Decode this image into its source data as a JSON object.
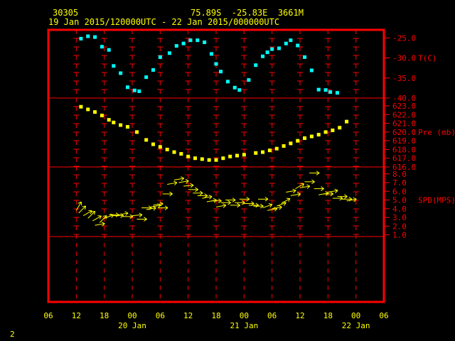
{
  "header": {
    "station": "30305",
    "location": "75.89S  -25.83E  3661M",
    "period": "19 Jan 2015/120000UTC - 22 Jan 2015/000000UTC"
  },
  "page_number": "2",
  "colors": {
    "frame": "#ff0000",
    "grid": "#ff0000",
    "header_text": "#ffff00",
    "time_labels": "#ffff00",
    "axis_labels": "#ff0000",
    "temperature": "#00ffff",
    "pressure": "#ffff00",
    "wind": "#ffff00"
  },
  "chart_data": {
    "type": "scatter",
    "x_axis": {
      "hour_ticks": [
        "06",
        "12",
        "18",
        "00",
        "06",
        "12",
        "18",
        "00",
        "06",
        "12",
        "18",
        "00",
        "06"
      ],
      "tick_hours_since_19jan_00utc": [
        6,
        12,
        18,
        24,
        30,
        36,
        42,
        48,
        54,
        60,
        66,
        72,
        78
      ],
      "day_labels": [
        "20 Jan",
        "21 Jan",
        "22 Jan"
      ],
      "day_label_hours_since_19jan_00utc": [
        24,
        48,
        72
      ]
    },
    "panels": [
      {
        "name": "temperature",
        "label": "T(C)",
        "ticks": [
          "-25.0",
          "-30.0",
          "-35.0",
          "-40.0"
        ],
        "tick_values": [
          -25,
          -30,
          -35,
          -40
        ],
        "ylim": [
          -40,
          -23
        ],
        "marker": "square",
        "x": [
          13,
          14.5,
          16,
          17.5,
          19,
          20,
          21.5,
          23,
          24.5,
          25.5,
          27,
          28.5,
          30,
          32,
          33.5,
          35,
          36.5,
          38,
          39.5,
          41,
          42,
          43,
          44.5,
          46,
          47,
          49,
          50.5,
          52,
          53,
          54,
          55.5,
          57,
          58,
          59.5,
          61,
          62.5,
          64,
          65.5,
          66.5,
          68
        ],
        "y": [
          -25.2,
          -24.6,
          -24.8,
          -27.2,
          -28.0,
          -32.0,
          -33.8,
          -37.3,
          -38.1,
          -38.3,
          -34.8,
          -33.0,
          -29.8,
          -28.8,
          -27.0,
          -26.4,
          -25.6,
          -25.6,
          -26.1,
          -29.0,
          -31.5,
          -33.4,
          -35.9,
          -37.4,
          -38.0,
          -35.5,
          -31.8,
          -29.6,
          -28.6,
          -27.8,
          -27.6,
          -26.4,
          -25.6,
          -26.9,
          -29.8,
          -33.1,
          -37.9,
          -38.0,
          -38.5,
          -38.7
        ]
      },
      {
        "name": "pressure",
        "label": "Pre (mb)",
        "ticks": [
          "623.0",
          "622.0",
          "621.0",
          "620.0",
          "619.0",
          "618.0",
          "617.0",
          "616.0"
        ],
        "tick_values": [
          623,
          622,
          621,
          620,
          619,
          618,
          617,
          616
        ],
        "ylim": [
          616,
          623.9
        ],
        "marker": "square",
        "x": [
          13,
          14.5,
          16,
          17.5,
          19,
          20,
          21.5,
          23,
          25,
          27,
          28.5,
          30,
          31.5,
          33,
          34.5,
          36,
          37.5,
          39,
          40.5,
          42,
          43.5,
          45,
          46.5,
          48,
          50.5,
          52,
          53.5,
          55,
          56.5,
          58,
          59.5,
          61,
          62.5,
          64,
          65.5,
          67,
          68.5,
          70
        ],
        "y": [
          622.9,
          622.6,
          622.3,
          621.9,
          621.4,
          621.1,
          620.8,
          620.6,
          620.0,
          619.1,
          618.6,
          618.3,
          618.0,
          617.7,
          617.5,
          617.2,
          617.0,
          616.9,
          616.8,
          616.8,
          617.0,
          617.2,
          617.3,
          617.4,
          617.6,
          617.7,
          617.9,
          618.1,
          618.4,
          618.7,
          619.0,
          619.3,
          619.5,
          619.7,
          620.0,
          620.2,
          620.5,
          621.2
        ]
      },
      {
        "name": "wind_speed",
        "label": "SPD(MPS)",
        "ticks": [
          "8.0",
          "7.0",
          "6.0",
          "5.0",
          "4.0",
          "3.0",
          "2.0",
          "1.0"
        ],
        "tick_values": [
          8,
          7,
          6,
          5,
          4,
          3,
          2,
          1
        ],
        "ylim": [
          0.8,
          8.8
        ],
        "marker": "wind-arrow",
        "x": [
          12,
          12.5,
          13.5,
          14.5,
          15.5,
          16,
          17,
          18,
          19,
          20,
          21,
          22,
          24,
          25,
          26,
          27,
          28,
          28.5,
          29.5,
          30.5,
          31.5,
          33,
          34,
          35,
          36,
          37,
          38,
          39,
          40,
          41,
          42,
          43,
          44,
          45,
          46,
          47,
          48,
          49,
          50,
          51,
          52,
          53,
          54,
          55,
          56,
          57,
          58,
          59,
          60,
          61,
          62,
          63,
          64,
          65,
          66,
          67,
          68,
          69,
          70
        ],
        "y": [
          3.8,
          3.5,
          3.2,
          2.9,
          2.6,
          2.1,
          2.4,
          2.9,
          3.3,
          3.2,
          3.3,
          3.1,
          3.2,
          2.8,
          4.1,
          3.9,
          4.2,
          4.4,
          4.1,
          5.7,
          6.8,
          7.3,
          7.0,
          6.6,
          6.2,
          5.8,
          5.5,
          5.2,
          4.8,
          4.9,
          4.2,
          4.7,
          5.0,
          4.4,
          4.7,
          5.1,
          4.6,
          4.4,
          4.3,
          5.1,
          4.1,
          3.8,
          4.0,
          4.3,
          4.6,
          5.9,
          5.5,
          6.3,
          6.4,
          7.1,
          8.1,
          6.3,
          5.6,
          5.7,
          5.9,
          5.2,
          5.4,
          5.1,
          4.9
        ],
        "direction_deg": [
          30,
          45,
          60,
          45,
          60,
          80,
          45,
          70,
          90,
          90,
          80,
          90,
          85,
          90,
          90,
          80,
          80,
          80,
          90,
          90,
          80,
          80,
          80,
          85,
          90,
          90,
          90,
          80,
          80,
          90,
          80,
          90,
          90,
          90,
          90,
          90,
          90,
          90,
          90,
          90,
          70,
          80,
          80,
          70,
          60,
          80,
          80,
          60,
          80,
          90,
          90,
          90,
          80,
          90,
          80,
          90,
          90,
          90,
          80
        ]
      }
    ],
    "grid": true
  }
}
